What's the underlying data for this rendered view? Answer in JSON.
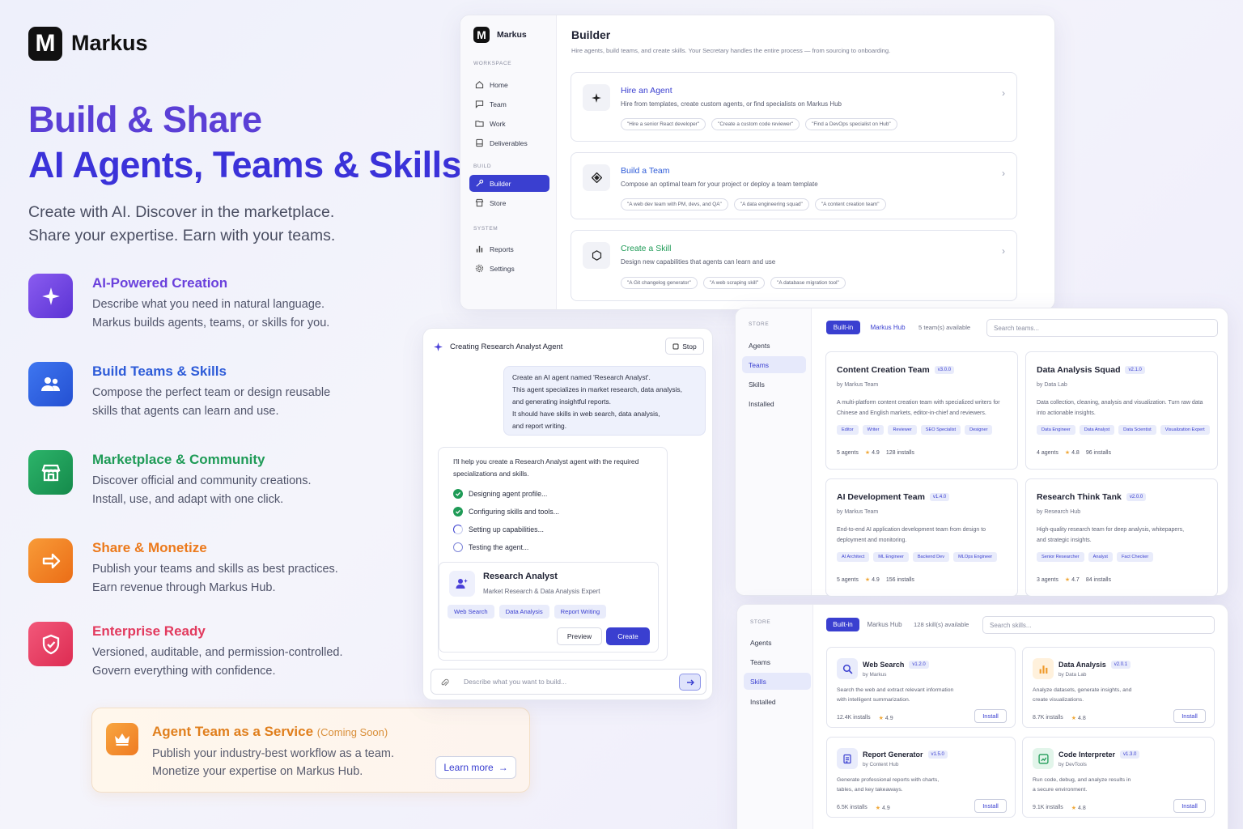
{
  "brand": {
    "name": "Markus",
    "mark": "M"
  },
  "hero": {
    "title_line1": "Build & Share",
    "title_line2": "AI Agents, Teams & Skills",
    "subtitle_line1": "Create with AI. Discover in the marketplace.",
    "subtitle_line2": "Share your expertise. Earn with your teams."
  },
  "features": [
    {
      "title": "AI-Powered Creation",
      "line1": "Describe what you need in natural language.",
      "line2": "Markus builds agents, teams, or skills for you.",
      "color": "#6a40dc",
      "icon": "sparkle-icon"
    },
    {
      "title": "Build Teams & Skills",
      "line1": "Compose the perfect team or design reusable",
      "line2": "skills that agents can learn and use.",
      "color": "#2d5bd8",
      "icon": "users-icon"
    },
    {
      "title": "Marketplace & Community",
      "line1": "Discover official and community creations.",
      "line2": "Install, use, and adapt with one click.",
      "color": "#1f9b57",
      "icon": "store-icon"
    },
    {
      "title": "Share & Monetize",
      "line1": "Publish your teams and skills as best practices.",
      "line2": "Earn revenue through Markus Hub.",
      "color": "#ec7a1c",
      "icon": "share-icon"
    },
    {
      "title": "Enterprise Ready",
      "line1": "Versioned, auditable, and permission-controlled.",
      "line2": "Govern everything with confidence.",
      "color": "#e23a5e",
      "icon": "shield-icon"
    }
  ],
  "promo": {
    "title": "Agent Team as a Service",
    "badge": "(Coming Soon)",
    "line1": "Publish your industry-best workflow as a team.",
    "line2": "Monetize your expertise on Markus Hub.",
    "cta": "Learn more"
  },
  "builder": {
    "app": "Markus",
    "sections": {
      "workspace": "WORKSPACE",
      "build": "BUILD",
      "system": "SYSTEM"
    },
    "nav": {
      "home": "Home",
      "team": "Team",
      "work": "Work",
      "deliverables": "Deliverables",
      "builder": "Builder",
      "store": "Store",
      "reports": "Reports",
      "settings": "Settings"
    },
    "title": "Builder",
    "subtitle": "Hire agents, build teams, and create skills. Your Secretary handles the entire process — from sourcing to onboarding.",
    "cards": [
      {
        "title": "Hire an Agent",
        "desc": "Hire from templates, create custom agents, or find specialists on Markus Hub",
        "chips": [
          "\"Hire a senior React developer\"",
          "\"Create a custom code reviewer\"",
          "\"Find a DevOps specialist on Hub\""
        ],
        "color": "#3a3fd0"
      },
      {
        "title": "Build a Team",
        "desc": "Compose an optimal team for your project or deploy a team template",
        "chips": [
          "\"A web dev team with PM, devs, and QA\"",
          "\"A data engineering squad\"",
          "\"A content creation team\""
        ],
        "color": "#2d5bd8"
      },
      {
        "title": "Create a Skill",
        "desc": "Design new capabilities that agents can learn and use",
        "chips": [
          "\"A Git changelog generator\"",
          "\"A web scraping skill\"",
          "\"A database migration tool\""
        ],
        "color": "#1f9b57"
      }
    ]
  },
  "chat": {
    "title": "Creating Research Analyst Agent",
    "stop": "Stop",
    "user_lines": [
      "Create an AI agent named 'Research Analyst'.",
      "This agent specializes in market research, data analysis,",
      "and generating insightful reports.",
      "It should have skills in web search, data analysis,",
      "and report writing."
    ],
    "assistant_lines": [
      "I'll help you create a Research Analyst agent with the required",
      "specializations and skills."
    ],
    "steps": [
      {
        "label": "Designing agent profile...",
        "state": "done"
      },
      {
        "label": "Configuring skills and tools...",
        "state": "done"
      },
      {
        "label": "Setting up capabilities...",
        "state": "progress"
      },
      {
        "label": "Testing the agent...",
        "state": "pending"
      }
    ],
    "agent": {
      "name": "Research Analyst",
      "role": "Market Research & Data Analysis Expert",
      "tags": [
        "Web Search",
        "Data Analysis",
        "Report Writing"
      ],
      "preview": "Preview",
      "create": "Create"
    },
    "input_placeholder": "Describe what you want to build..."
  },
  "store_teams": {
    "section": "STORE",
    "nav": [
      "Agents",
      "Teams",
      "Skills",
      "Installed"
    ],
    "tab_builtin": "Built-in",
    "tab_hub": "Markus Hub",
    "available": "5 team(s) available",
    "search_placeholder": "Search teams...",
    "cards": [
      {
        "title": "Content Creation Team",
        "version": "v3.0.0",
        "by": "by Markus Team",
        "desc_lines": [
          "A multi-platform content creation team with specialized writers for",
          "Chinese and English markets, editor-in-chief and reviewers."
        ],
        "tags": [
          "Editor",
          "Writer",
          "Reviewer",
          "SEO Specialist",
          "Designer"
        ],
        "agents": "5 agents",
        "rating": "4.9",
        "installs": "128 installs"
      },
      {
        "title": "Data Analysis Squad",
        "version": "v2.1.0",
        "by": "by Data Lab",
        "desc_lines": [
          "Data collection, cleaning, analysis and visualization. Turn raw data",
          "into actionable insights."
        ],
        "tags": [
          "Data Engineer",
          "Data Analyst",
          "Data Scientist",
          "Visualization Expert"
        ],
        "agents": "4 agents",
        "rating": "4.8",
        "installs": "96 installs"
      },
      {
        "title": "AI Development Team",
        "version": "v1.4.0",
        "by": "by Markus Team",
        "desc_lines": [
          "End-to-end AI application development team from design to",
          "deployment and monitoring."
        ],
        "tags": [
          "AI Architect",
          "ML Engineer",
          "Backend Dev",
          "MLOps Engineer"
        ],
        "agents": "5 agents",
        "rating": "4.9",
        "installs": "156 installs"
      },
      {
        "title": "Research Think Tank",
        "version": "v2.0.0",
        "by": "by Research Hub",
        "desc_lines": [
          "High-quality research team for deep analysis, whitepapers,",
          "and strategic insights."
        ],
        "tags": [
          "Senior Researcher",
          "Analyst",
          "Fact Checker"
        ],
        "agents": "3 agents",
        "rating": "4.7",
        "installs": "84 installs"
      }
    ]
  },
  "store_skills": {
    "section": "STORE",
    "nav": [
      "Agents",
      "Teams",
      "Skills",
      "Installed"
    ],
    "tab_builtin": "Built-in",
    "tab_hub": "Markus Hub",
    "available": "128 skill(s) available",
    "search_placeholder": "Search skills...",
    "install": "Install",
    "cards": [
      {
        "title": "Web Search",
        "version": "v1.2.0",
        "by": "by Markus",
        "desc_lines": [
          "Search the web and extract relevant information",
          "with intelligent summarization."
        ],
        "installs": "12.4K installs",
        "rating": "4.9",
        "icon": "search-icon",
        "color": "#3a3fd0",
        "bg": "#e9ecfb"
      },
      {
        "title": "Data Analysis",
        "version": "v2.0.1",
        "by": "by Data Lab",
        "desc_lines": [
          "Analyze datasets, generate insights, and",
          "create visualizations."
        ],
        "installs": "8.7K installs",
        "rating": "4.8",
        "icon": "bar-chart-icon",
        "color": "#ef9a2a",
        "bg": "#fff1dc"
      },
      {
        "title": "Report Generator",
        "version": "v1.5.0",
        "by": "by Content Hub",
        "desc_lines": [
          "Generate professional reports with charts,",
          "tables, and key takeaways."
        ],
        "installs": "6.5K installs",
        "rating": "4.9",
        "icon": "document-icon",
        "color": "#3a3fd0",
        "bg": "#e9ecfb"
      },
      {
        "title": "Code Interpreter",
        "version": "v1.3.0",
        "by": "by DevTools",
        "desc_lines": [
          "Run code, debug, and analyze results in",
          "a secure environment."
        ],
        "installs": "9.1K installs",
        "rating": "4.8",
        "icon": "code-icon",
        "color": "#1f9b57",
        "bg": "#e2f5ea"
      }
    ]
  }
}
